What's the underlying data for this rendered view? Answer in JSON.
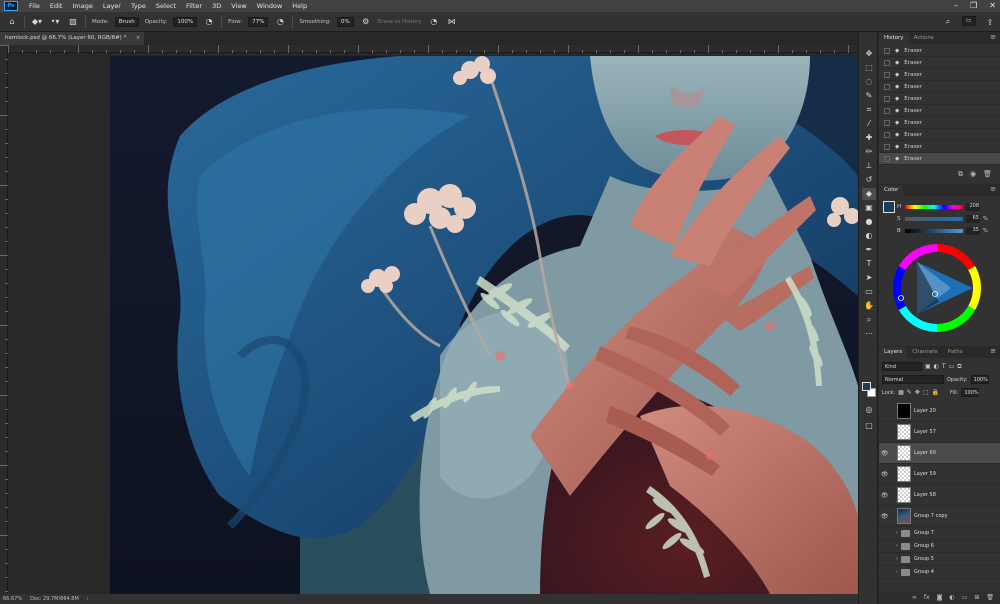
{
  "menubar": {
    "items": [
      "File",
      "Edit",
      "Image",
      "Layer",
      "Type",
      "Select",
      "Filter",
      "3D",
      "View",
      "Window",
      "Help"
    ]
  },
  "options": {
    "mode_label": "Mode:",
    "mode_value": "Brush",
    "opacity_label": "Opacity:",
    "opacity_value": "100%",
    "flow_label": "Flow:",
    "flow_value": "77%",
    "smoothing_label": "Smoothing:",
    "smoothing_value": "0%",
    "erase_history_label": "Erase to History"
  },
  "document": {
    "tab_title": "hemlock.psd @ 66.7% (Layer 60, RGB/8#) *",
    "zoom": "66.67%",
    "doc_size": "Doc: 29.7M/864.8M"
  },
  "history": {
    "tabs": [
      "History",
      "Actions"
    ],
    "items": [
      "Eraser",
      "Eraser",
      "Eraser",
      "Eraser",
      "Eraser",
      "Eraser",
      "Eraser",
      "Eraser",
      "Eraser",
      "Eraser"
    ]
  },
  "color": {
    "title": "Color",
    "fg": "#1d3d58",
    "h": {
      "label": "H",
      "value": "208",
      "unit": ""
    },
    "s": {
      "label": "S",
      "value": "65",
      "unit": "%"
    },
    "b": {
      "label": "B",
      "value": "35",
      "unit": "%"
    }
  },
  "layers": {
    "tabs": [
      "Layers",
      "Channels",
      "Paths"
    ],
    "kind_label": "Kind",
    "blend_mode": "Normal",
    "opacity_label": "Opacity:",
    "opacity_value": "100%",
    "lock_label": "Lock:",
    "fill_label": "Fill:",
    "fill_value": "100%",
    "rows": [
      {
        "name": "Layer 20",
        "visible": false,
        "thumb": "black",
        "selected": false
      },
      {
        "name": "Layer 57",
        "visible": false,
        "thumb": "transparent",
        "selected": false
      },
      {
        "name": "Layer 60",
        "visible": true,
        "thumb": "transparent",
        "selected": true
      },
      {
        "name": "Layer 59",
        "visible": true,
        "thumb": "transparent",
        "selected": false
      },
      {
        "name": "Layer 58",
        "visible": true,
        "thumb": "transparent",
        "selected": false
      },
      {
        "name": "Group 7 copy",
        "visible": true,
        "thumb": "art",
        "selected": false
      }
    ],
    "groups": [
      "Group 7",
      "Group 6",
      "Group 5",
      "Group 4"
    ]
  },
  "tools": [
    "move-icon",
    "marquee-icon",
    "lasso-icon",
    "quick-select-icon",
    "crop-icon",
    "eyedropper-icon",
    "healing-icon",
    "brush-icon",
    "clone-stamp-icon",
    "history-brush-icon",
    "eraser-icon",
    "gradient-icon",
    "blur-icon",
    "dodge-icon",
    "pen-icon",
    "type-icon",
    "path-select-icon",
    "shape-icon",
    "hand-icon",
    "zoom-icon",
    "more-icon"
  ]
}
